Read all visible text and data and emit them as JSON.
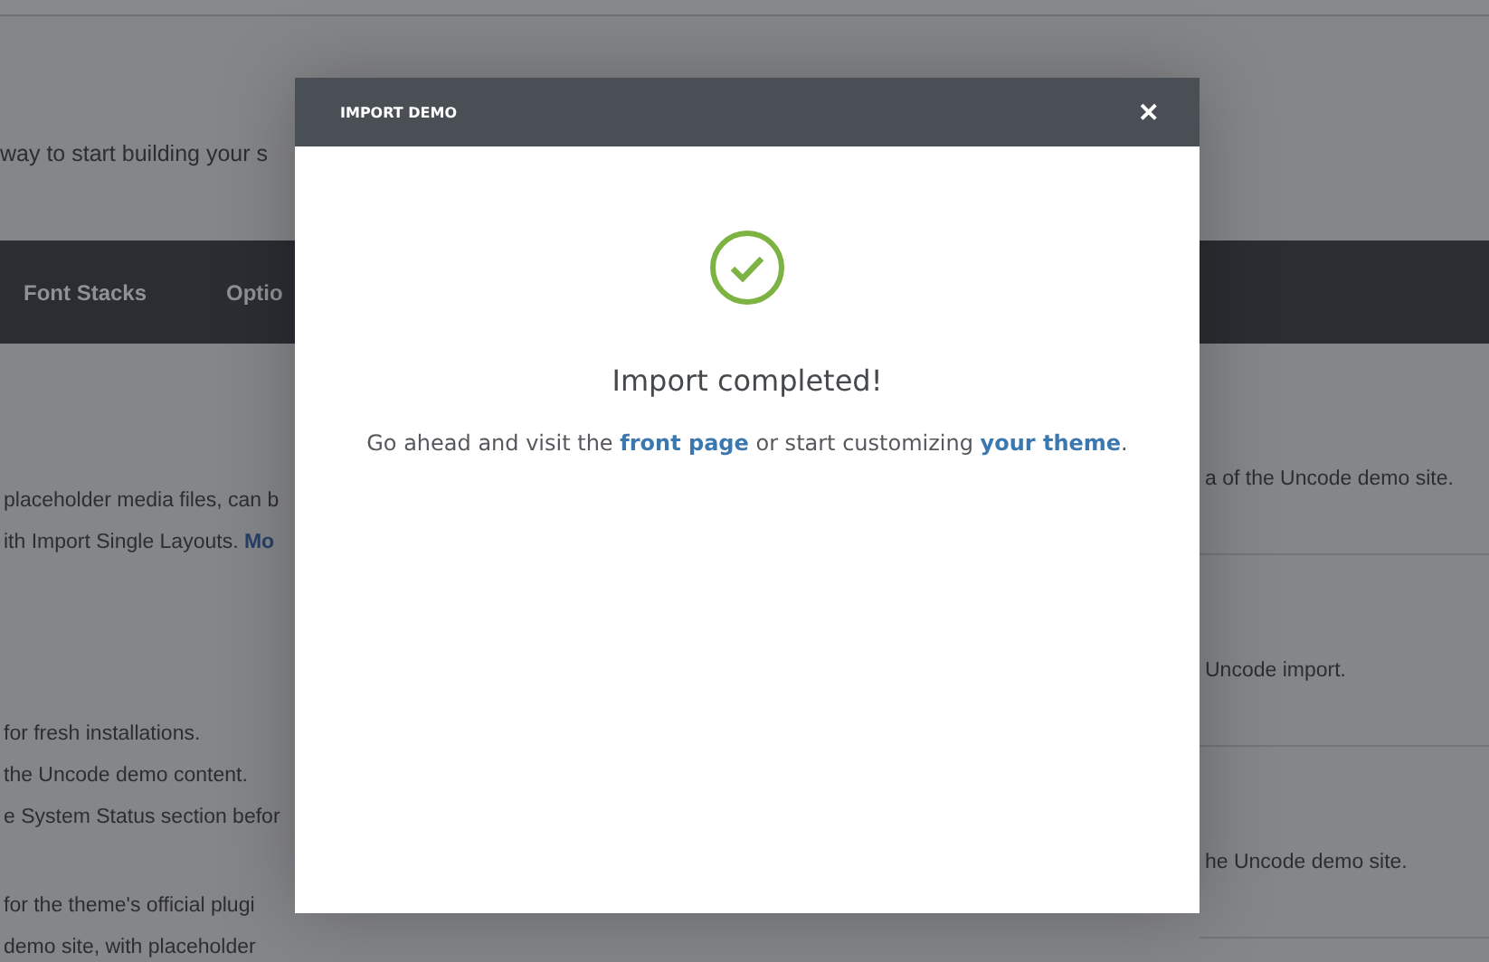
{
  "page": {
    "subtitle": "way to start building your s",
    "tabs": [
      {
        "label": "Font Stacks"
      },
      {
        "label": "Optio"
      }
    ],
    "left_sections": [
      [
        {
          "text": "placeholder media files, can b"
        },
        {
          "text": "ith Import Single Layouts. ",
          "link": "Mo"
        }
      ],
      [
        {
          "text": "for fresh installations."
        },
        {
          "text": "the Uncode demo content."
        },
        {
          "text": "e System Status section befor"
        }
      ],
      [
        {
          "text": "for the theme's official plugi"
        },
        {
          "text": "demo site, with placeholder"
        }
      ]
    ],
    "right_rows": [
      {
        "text": "a of the Uncode demo site."
      },
      {
        "text": "Uncode import."
      },
      {
        "text": "he Uncode demo site."
      }
    ]
  },
  "dialog": {
    "title": "IMPORT DEMO",
    "close": "✕",
    "heading": "Import completed!",
    "message": [
      {
        "kind": "text",
        "text": "Go ahead and visit the "
      },
      {
        "kind": "link",
        "text": "front page"
      },
      {
        "kind": "text",
        "text": " or start customizing "
      },
      {
        "kind": "link",
        "text": "your theme"
      },
      {
        "kind": "text",
        "text": "."
      }
    ]
  }
}
